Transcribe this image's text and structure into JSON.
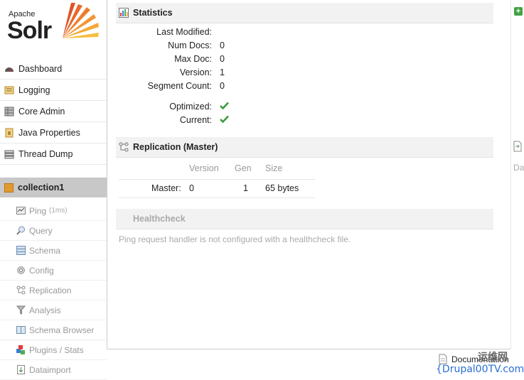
{
  "logo": {
    "apache": "Apache",
    "solr": "Solr"
  },
  "nav": {
    "items": [
      {
        "label": "Dashboard",
        "icon": "dashboard-icon"
      },
      {
        "label": "Logging",
        "icon": "logging-icon"
      },
      {
        "label": "Core Admin",
        "icon": "core-admin-icon"
      },
      {
        "label": "Java Properties",
        "icon": "java-properties-icon"
      },
      {
        "label": "Thread Dump",
        "icon": "thread-dump-icon"
      }
    ],
    "collection": "collection1",
    "sub_items": [
      {
        "label": "Ping",
        "extra": "(1ms)",
        "icon": "ping-icon"
      },
      {
        "label": "Query",
        "icon": "query-icon"
      },
      {
        "label": "Schema",
        "icon": "schema-icon"
      },
      {
        "label": "Config",
        "icon": "config-icon"
      },
      {
        "label": "Replication",
        "icon": "replication-icon"
      },
      {
        "label": "Analysis",
        "icon": "analysis-icon"
      },
      {
        "label": "Schema Browser",
        "icon": "schema-browser-icon"
      },
      {
        "label": "Plugins / Stats",
        "icon": "plugins-icon"
      },
      {
        "label": "Dataimport",
        "icon": "dataimport-icon"
      }
    ]
  },
  "statistics": {
    "title": "Statistics",
    "rows": [
      {
        "key": "Last Modified:",
        "value": ""
      },
      {
        "key": "Num Docs:",
        "value": "0"
      },
      {
        "key": "Max Doc:",
        "value": "0"
      },
      {
        "key": "Version:",
        "value": "1"
      },
      {
        "key": "Segment Count:",
        "value": "0"
      }
    ],
    "optimized_label": "Optimized:",
    "current_label": "Current:"
  },
  "replication": {
    "title": "Replication (Master)",
    "headers": {
      "version": "Version",
      "gen": "Gen",
      "size": "Size"
    },
    "row": {
      "label": "Master:",
      "version": "0",
      "gen": "1",
      "size": "65 bytes"
    }
  },
  "healthcheck": {
    "title": "Healthcheck",
    "message": "Ping request handler is not configured with a healthcheck file."
  },
  "right": {
    "da": "Da"
  },
  "footer": {
    "documentation": "Documentation"
  },
  "watermark": {
    "cn": "运维网",
    "url": "{Drupal00TV.com}"
  },
  "colors": {
    "accent_green": "#43a243",
    "collection_bg": "#c8c8c8"
  }
}
